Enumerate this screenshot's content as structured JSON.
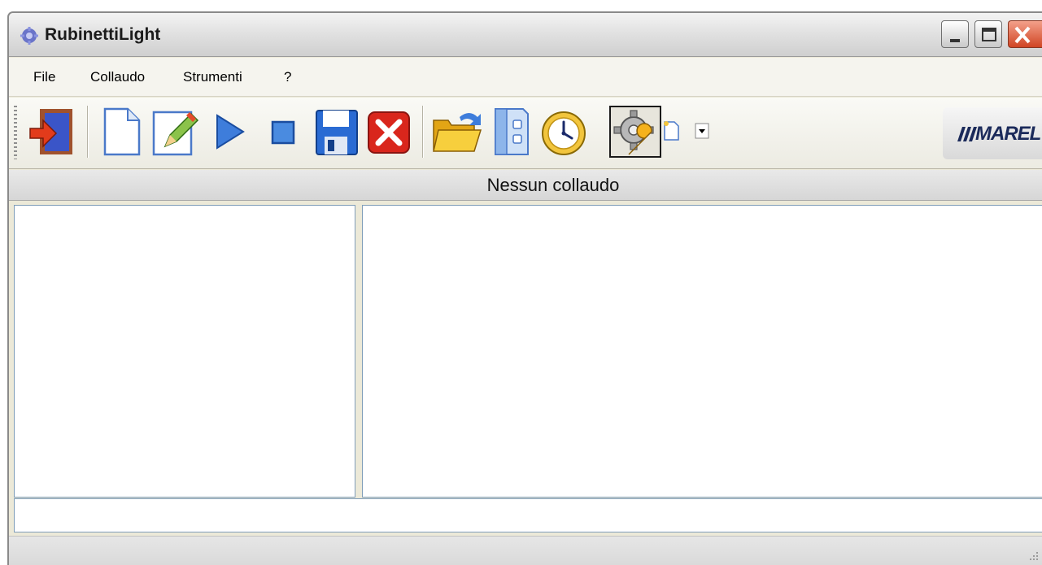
{
  "window": {
    "title": "RubinettiLight"
  },
  "menu": {
    "items": [
      {
        "label": "File"
      },
      {
        "label": "Collaudo"
      },
      {
        "label": "Strumenti"
      },
      {
        "label": "?"
      }
    ]
  },
  "toolbar": {
    "buttons": [
      {
        "icon": "exit-door-icon"
      },
      {
        "icon": "new-document-icon"
      },
      {
        "icon": "edit-pencil-icon"
      },
      {
        "icon": "play-icon"
      },
      {
        "icon": "stop-icon"
      },
      {
        "icon": "save-floppy-icon"
      },
      {
        "icon": "delete-x-icon"
      },
      {
        "icon": "open-folder-icon"
      },
      {
        "icon": "binder-icon"
      },
      {
        "icon": "clock-icon"
      },
      {
        "icon": "settings-gear-wrench-icon",
        "state": "pressed"
      },
      {
        "icon": "new-document-dropdown-icon"
      }
    ],
    "logo_text": "MAREL"
  },
  "header": {
    "status_text": "Nessun collaudo"
  },
  "colors": {
    "pane_border": "#7f9db9",
    "close_button": "#d04524",
    "window_bg": "#ece9d8"
  }
}
